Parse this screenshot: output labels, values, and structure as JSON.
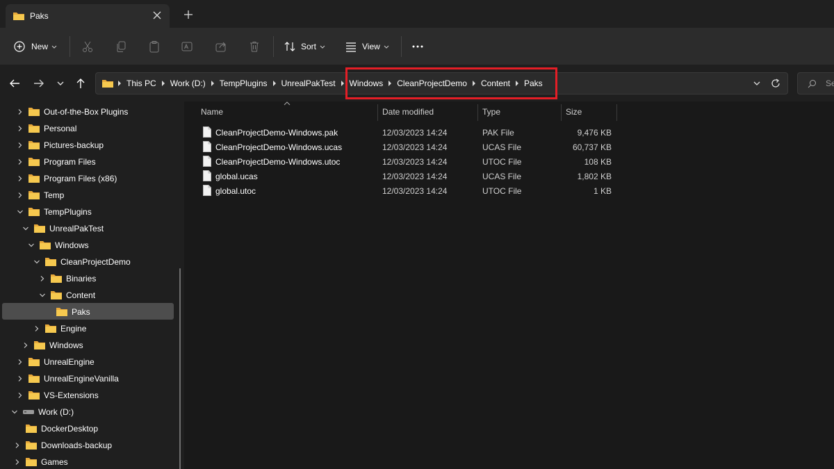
{
  "window": {
    "tab_title": "Paks",
    "tab_icon": "folder-icon"
  },
  "toolbar": {
    "new_label": "New",
    "sort_label": "Sort",
    "view_label": "View",
    "icons": [
      "add-icon",
      "cut-icon",
      "copy-icon",
      "paste-icon",
      "rename-icon",
      "share-icon",
      "delete-icon",
      "sort-icon",
      "view-icon",
      "more-icon"
    ]
  },
  "address": {
    "crumbs": [
      "This PC",
      "Work (D:)",
      "TempPlugins",
      "UnrealPakTest",
      "Windows",
      "CleanProjectDemo",
      "Content",
      "Paks"
    ],
    "search_placeholder": "Se"
  },
  "sidebar": {
    "items": [
      {
        "label": "Out-of-the-Box Plugins"
      },
      {
        "label": "Personal"
      },
      {
        "label": "Pictures-backup"
      },
      {
        "label": "Program Files"
      },
      {
        "label": "Program Files (x86)"
      },
      {
        "label": "Temp"
      },
      {
        "label": "TempPlugins"
      },
      {
        "label": "UnrealPakTest"
      },
      {
        "label": "Windows"
      },
      {
        "label": "CleanProjectDemo"
      },
      {
        "label": "Binaries"
      },
      {
        "label": "Content"
      },
      {
        "label": "Paks"
      },
      {
        "label": "Engine"
      },
      {
        "label": "Windows"
      },
      {
        "label": "UnrealEngine"
      },
      {
        "label": "UnrealEngineVanilla"
      },
      {
        "label": "VS-Extensions"
      },
      {
        "label": "Work (D:)"
      },
      {
        "label": "DockerDesktop"
      },
      {
        "label": "Downloads-backup"
      },
      {
        "label": "Games"
      }
    ]
  },
  "files": {
    "columns": {
      "name": "Name",
      "date": "Date modified",
      "type": "Type",
      "size": "Size"
    },
    "rows": [
      {
        "name": "CleanProjectDemo-Windows.pak",
        "date": "12/03/2023 14:24",
        "type": "PAK File",
        "size": "9,476 KB"
      },
      {
        "name": "CleanProjectDemo-Windows.ucas",
        "date": "12/03/2023 14:24",
        "type": "UCAS File",
        "size": "60,737 KB"
      },
      {
        "name": "CleanProjectDemo-Windows.utoc",
        "date": "12/03/2023 14:24",
        "type": "UTOC File",
        "size": "108 KB"
      },
      {
        "name": "global.ucas",
        "date": "12/03/2023 14:24",
        "type": "UCAS File",
        "size": "1,802 KB"
      },
      {
        "name": "global.utoc",
        "date": "12/03/2023 14:24",
        "type": "UTOC File",
        "size": "1 KB"
      }
    ]
  },
  "colors": {
    "highlight": "#e41e26",
    "folder": "#f2c24f",
    "selection": "#4d4d4d"
  }
}
